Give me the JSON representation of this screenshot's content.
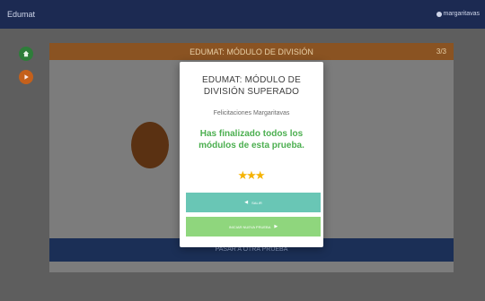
{
  "app": {
    "title": "Edumat",
    "user": "margaritavas"
  },
  "side": {
    "home_icon": "home-icon",
    "play_icon": "play-icon"
  },
  "card": {
    "title": "EDUMAT: MÓDULO DE DIVISIÓN",
    "progress": "3/3",
    "footer_label": "PASAR A OTRA PRUEBA"
  },
  "modal": {
    "title": "EDUMAT: MÓDULO DE DIVISIÓN SUPERADO",
    "congrats": "Felicitaciones Margaritavas",
    "message": "Has finalizado todos los módulos de esta prueba.",
    "stars": 3,
    "exit_label": "SALIR",
    "next_label": "INICIAR NUEVA PRUEBA"
  },
  "colors": {
    "topbar": "#1c2a52",
    "card_header": "#8a5322",
    "success_text": "#4caf50",
    "exit_button": "#69c6b5",
    "next_button": "#8fd67d",
    "star": "#f5b301"
  }
}
